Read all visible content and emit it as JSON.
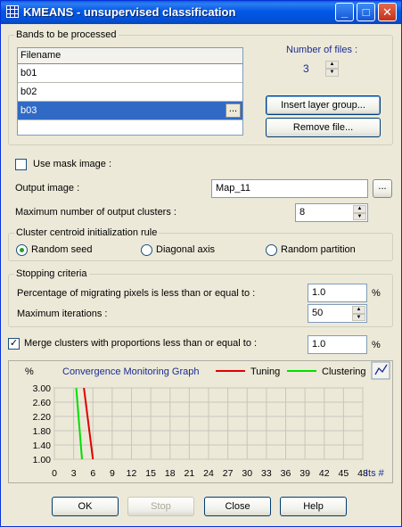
{
  "window": {
    "title": "KMEANS - unsupervised classification",
    "controls": {
      "minimize": "_",
      "maximize": "□",
      "close": "✕"
    }
  },
  "bands": {
    "group_title": "Bands to be processed",
    "column_header": "Filename",
    "files": [
      "b01",
      "b02",
      "b03"
    ],
    "selected_index": 2,
    "ellipsis": "...",
    "number_of_files_label": "Number of files :",
    "number_of_files": "3",
    "insert_button": "Insert layer group...",
    "remove_button": "Remove file..."
  },
  "mask": {
    "label": "Use mask image :",
    "checked": false
  },
  "output": {
    "label": "Output image :",
    "value": "Map_11",
    "browse": "..."
  },
  "max_clusters": {
    "label": "Maximum number of output clusters :",
    "value": "8"
  },
  "init_rule": {
    "group_title": "Cluster centroid initialization rule",
    "options": [
      "Random seed",
      "Diagonal axis",
      "Random partition"
    ],
    "selected": "Random seed"
  },
  "stopping": {
    "group_title": "Stopping criteria",
    "pct_label": "Percentage of migrating pixels is less than or equal to :",
    "pct_value": "1.0",
    "pct_unit": "%",
    "iter_label": "Maximum iterations :",
    "iter_value": "50"
  },
  "merge": {
    "label": "Merge clusters with proportions less than or equal to :",
    "checked": true,
    "value": "1.0",
    "unit": "%"
  },
  "chart_data": {
    "type": "line",
    "title": "Convergence Monitoring Graph",
    "ylabel": "%",
    "xlabel": "Its #",
    "ylim": [
      1.0,
      3.0
    ],
    "xlim": [
      0,
      48
    ],
    "y_ticks": [
      "3.00",
      "2.60",
      "2.20",
      "1.80",
      "1.40",
      "1.00"
    ],
    "x_ticks": [
      "0",
      "3",
      "6",
      "9",
      "12",
      "15",
      "18",
      "21",
      "24",
      "27",
      "30",
      "33",
      "36",
      "39",
      "42",
      "45",
      "48"
    ],
    "grid": true,
    "legend": "top",
    "series": [
      {
        "name": "Tuning",
        "color": "#E00000",
        "points": [
          [
            4.6,
            3.0
          ],
          [
            6.0,
            1.0
          ]
        ]
      },
      {
        "name": "Clustering",
        "color": "#00E000",
        "points": [
          [
            3.4,
            3.0
          ],
          [
            4.3,
            1.0
          ]
        ]
      }
    ]
  },
  "buttons": {
    "ok": "OK",
    "stop": "Stop",
    "close": "Close",
    "help": "Help"
  }
}
